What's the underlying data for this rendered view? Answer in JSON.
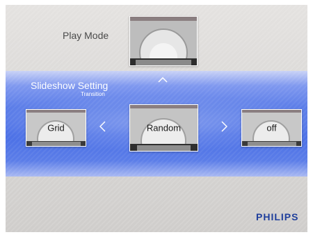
{
  "play_mode": {
    "label": "Play Mode"
  },
  "slideshow": {
    "title": "Slideshow Setting",
    "subtitle": "Transition",
    "options": {
      "left": "Grid",
      "center": "Random",
      "right": "off"
    }
  },
  "nav": {
    "up_icon": "chevron-up-icon",
    "left_icon": "chevron-left-icon",
    "right_icon": "chevron-right-icon"
  },
  "brand": {
    "name": "PHILIPS",
    "color": "#1f3f9c"
  },
  "colors": {
    "band": "#4a6fe6",
    "background": "#dcdad8",
    "thumbnail_frame": "#ffffff"
  }
}
